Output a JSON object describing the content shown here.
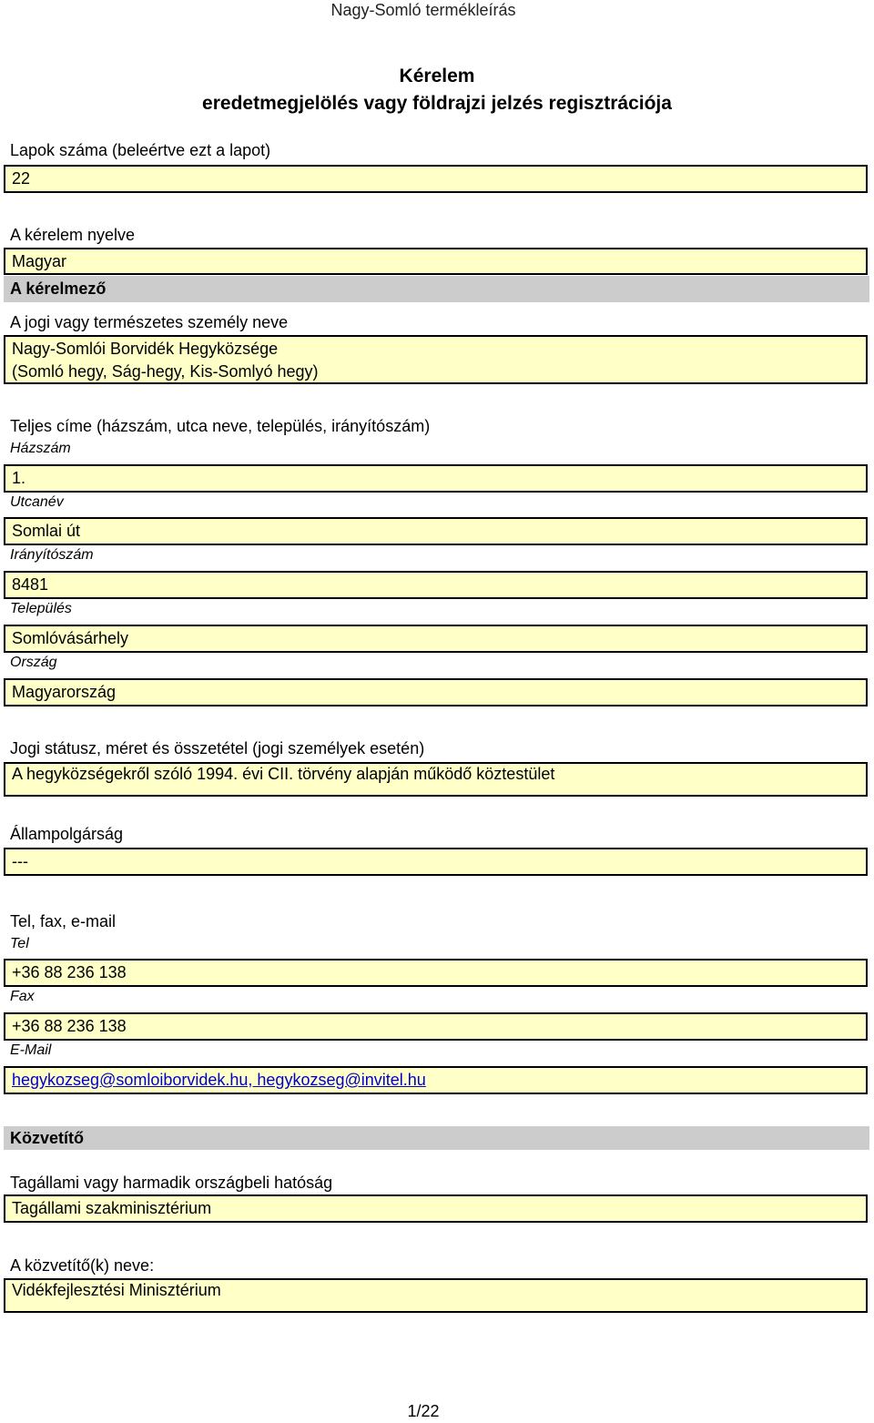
{
  "header": {
    "title": "Nagy-Somló termékleírás"
  },
  "form_title": {
    "line1": "Kérelem",
    "line2": "eredetmegjelölés vagy földrajzi jelzés regisztrációja"
  },
  "pages": {
    "label": "Lapok száma (beleértve ezt a lapot)",
    "value": "22"
  },
  "language": {
    "label": "A kérelem nyelve",
    "value": "Magyar"
  },
  "applicant": {
    "section": "A kérelmező",
    "name_label": "A jogi vagy természetes személy neve",
    "name_line1": "Nagy-Somlói Borvidék Hegyközsége",
    "name_line2": "(Somló hegy, Ság-hegy, Kis-Somlyó hegy)",
    "address_label": "Teljes címe (házszám, utca neve, település, irányítószám)",
    "house_label": "Házszám",
    "house_value": "1.",
    "street_label": "Utcanév",
    "street_value": "Somlai út",
    "zip_label": "Irányítószám",
    "zip_value": "8481",
    "city_label": "Település",
    "city_value": "Somlóvásárhely",
    "country_label": "Ország",
    "country_value": "Magyarország",
    "status_label": "Jogi státusz, méret és összetétel (jogi személyek esetén)",
    "status_value": "A hegyközségekről szóló 1994. évi CII. törvény alapján működő köztestület",
    "citizenship_label": "Állampolgárság",
    "citizenship_value": "---",
    "contact_label": "Tel, fax, e-mail",
    "tel_label": "Tel",
    "tel_value": "+36 88 236 138",
    "fax_label": "Fax",
    "fax_value": "+36 88 236 138",
    "email_label": "E-Mail",
    "email_value": "hegykozseg@somloiborvidek.hu, hegykozseg@invitel.hu"
  },
  "intermediary": {
    "section": "Közvetítő",
    "authority_label": "Tagállami vagy harmadik országbeli hatóság",
    "authority_value": "Tagállami szakminisztérium",
    "name_label": "A közvetítő(k) neve:",
    "name_value": "Vidékfejlesztési Minisztérium"
  },
  "footer": {
    "page": "1/22"
  }
}
